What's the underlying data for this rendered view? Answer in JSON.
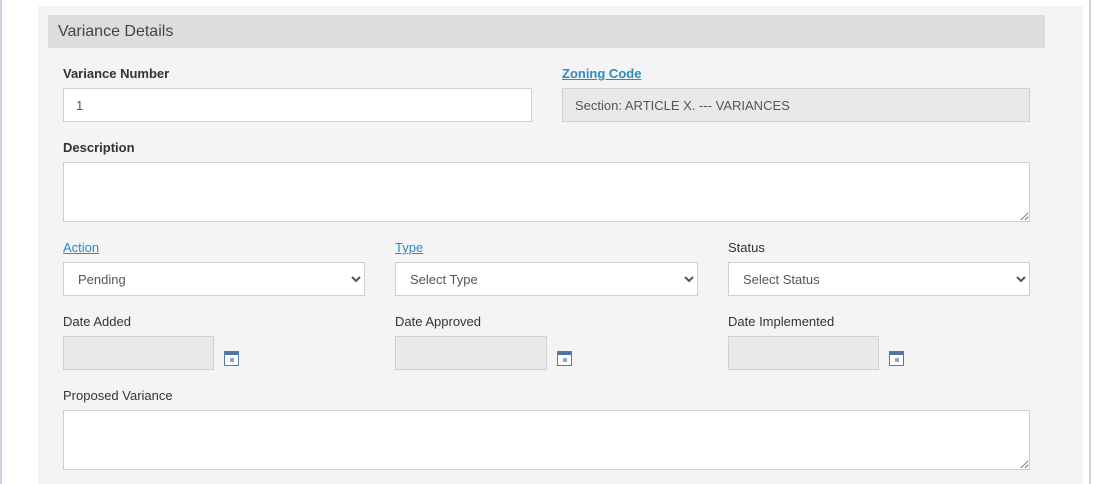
{
  "section": {
    "title": "Variance Details"
  },
  "variance_number": {
    "label": "Variance Number",
    "value": "1"
  },
  "zoning_code": {
    "label": "Zoning Code",
    "value": "Section: ARTICLE X. --- VARIANCES"
  },
  "description": {
    "label": "Description",
    "value": ""
  },
  "action": {
    "label": "Action",
    "selected": "Pending"
  },
  "type": {
    "label": "Type",
    "selected": "Select Type"
  },
  "status": {
    "label": "Status",
    "selected": "Select Status"
  },
  "date_added": {
    "label": "Date Added",
    "value": ""
  },
  "date_approved": {
    "label": "Date Approved",
    "value": ""
  },
  "date_implemented": {
    "label": "Date Implemented",
    "value": ""
  },
  "proposed_variance": {
    "label": "Proposed Variance",
    "value": ""
  },
  "icons": {
    "calendar": "calendar-icon",
    "dropdown": "chevron-down-icon"
  },
  "colors": {
    "link": "#2d8ac3",
    "header_bg": "#dddddd",
    "panel_bg": "#f4f4f4",
    "readonly_bg": "#e9e9e9"
  }
}
